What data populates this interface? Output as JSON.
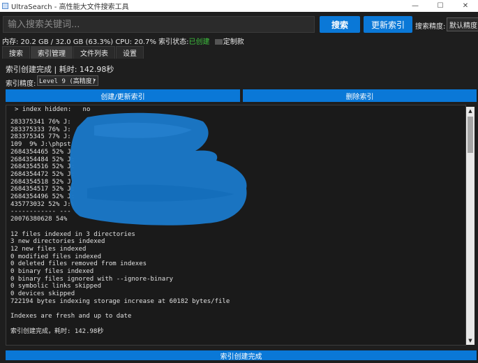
{
  "window": {
    "title": "UltraSearch - 高性能大文件搜索工具",
    "controls": [
      "—",
      "☐",
      "✕"
    ]
  },
  "search": {
    "placeholder": "输入搜索关键词...",
    "search_label": "搜索",
    "update_index_label": "更新索引",
    "precision_label": "搜索精度:",
    "precision_value": "默认精度"
  },
  "status": {
    "memory": "内存: 20.2 GB / 32.0 GB (63.3%)",
    "cpu": "CPU: 20.7%",
    "index_status_label": "索引状态:",
    "index_status_value": "已创建",
    "extra": "定制款"
  },
  "tabs": [
    {
      "label": "搜索",
      "active": false
    },
    {
      "label": "索引管理",
      "active": true
    },
    {
      "label": "文件列表",
      "active": false
    },
    {
      "label": "设置",
      "active": false
    }
  ],
  "index_panel": {
    "result": "索引创建完成 | 耗时: 142.98秒",
    "level_label": "索引精度:",
    "level_value": "Level 9 (高精度)",
    "create_label": "创建/更新索引",
    "delete_label": "删除索引"
  },
  "log": {
    "first_line": "> index hidden:   no",
    "lines": "283375341 76% J:\n283375333 76% J:\n283375345 77% J:\n109  9% J:\\phpst\n2684354465 52% J\n2684354484 52% J:\n2684354516 52% J:\n2684354472 52% J:\n2684354518 52% J:\n2684354517 52% J:\n2684354496 52% J:\n435773032 52% J:\\\n------------ ---\n20076380628 54%\n\n12 files indexed in 3 directories\n3 new directories indexed\n12 new files indexed\n0 modified files indexed\n0 deleted files removed from indexes\n0 binary files indexed\n0 binary files ignored with --ignore-binary\n0 symbolic links skipped\n0 devices skipped\n722194 bytes indexing storage increase at 60182 bytes/file\n\nIndexes are fresh and up to date\n\n索引创建完成，耗时: 142.98秒"
  },
  "footer": {
    "status": "索引创建完成"
  },
  "colors": {
    "accent": "#0a78d7",
    "ok": "#3ec23e",
    "background": "#1e1e1e"
  }
}
